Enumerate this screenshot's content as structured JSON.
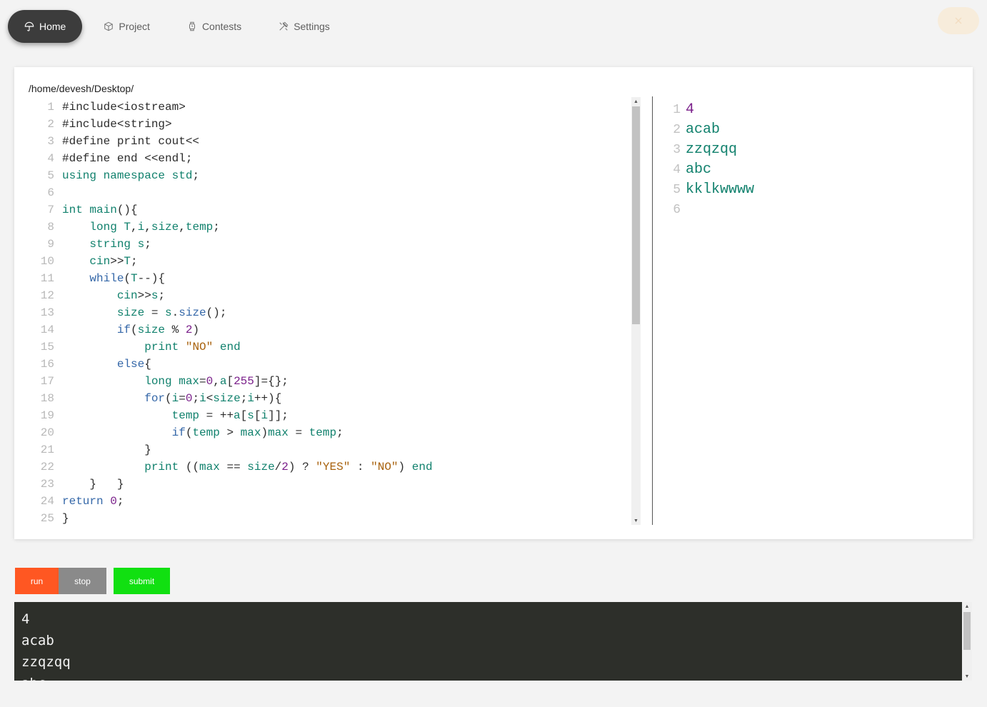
{
  "nav": {
    "items": [
      {
        "label": "Home",
        "icon": "umbrella-icon",
        "active": true
      },
      {
        "label": "Project",
        "icon": "cube-icon",
        "active": false
      },
      {
        "label": "Contests",
        "icon": "watch-icon",
        "active": false
      },
      {
        "label": "Settings",
        "icon": "tools-icon",
        "active": false
      }
    ],
    "close_icon": "close-icon"
  },
  "editor": {
    "path": "/home/devesh/Desktop/",
    "lines": [
      {
        "n": "1",
        "tokens": [
          [
            "t",
            "#include<iostream>"
          ]
        ]
      },
      {
        "n": "2",
        "tokens": [
          [
            "t",
            "#include<string>"
          ]
        ]
      },
      {
        "n": "3",
        "tokens": [
          [
            "t",
            "#define print cout<<"
          ]
        ]
      },
      {
        "n": "4",
        "tokens": [
          [
            "t",
            "#define end <<endl;"
          ]
        ]
      },
      {
        "n": "5",
        "tokens": [
          [
            "ty",
            "using namespace std"
          ],
          [
            "t",
            ";"
          ]
        ]
      },
      {
        "n": "6",
        "tokens": []
      },
      {
        "n": "7",
        "tokens": [
          [
            "ty",
            "int main"
          ],
          [
            "t",
            "(){"
          ]
        ]
      },
      {
        "n": "8",
        "tokens": [
          [
            "t",
            "    "
          ],
          [
            "ty",
            "long T"
          ],
          [
            "t",
            ","
          ],
          [
            "ty",
            "i"
          ],
          [
            "t",
            ","
          ],
          [
            "ty",
            "size"
          ],
          [
            "t",
            ","
          ],
          [
            "ty",
            "temp"
          ],
          [
            "t",
            ";"
          ]
        ]
      },
      {
        "n": "9",
        "tokens": [
          [
            "t",
            "    "
          ],
          [
            "ty",
            "string s"
          ],
          [
            "t",
            ";"
          ]
        ]
      },
      {
        "n": "10",
        "tokens": [
          [
            "t",
            "    "
          ],
          [
            "ty",
            "cin"
          ],
          [
            "t",
            ">>"
          ],
          [
            "ty",
            "T"
          ],
          [
            "t",
            ";"
          ]
        ]
      },
      {
        "n": "11",
        "tokens": [
          [
            "t",
            "    "
          ],
          [
            "kw",
            "while"
          ],
          [
            "t",
            "("
          ],
          [
            "ty",
            "T"
          ],
          [
            "t",
            "--){"
          ]
        ]
      },
      {
        "n": "12",
        "tokens": [
          [
            "t",
            "        "
          ],
          [
            "ty",
            "cin"
          ],
          [
            "t",
            ">>"
          ],
          [
            "ty",
            "s"
          ],
          [
            "t",
            ";"
          ]
        ]
      },
      {
        "n": "13",
        "tokens": [
          [
            "t",
            "        "
          ],
          [
            "ty",
            "size"
          ],
          [
            "t",
            " = "
          ],
          [
            "ty",
            "s"
          ],
          [
            "t",
            "."
          ],
          [
            "kw",
            "size"
          ],
          [
            "t",
            "();"
          ]
        ]
      },
      {
        "n": "14",
        "tokens": [
          [
            "t",
            "        "
          ],
          [
            "kw",
            "if"
          ],
          [
            "t",
            "("
          ],
          [
            "ty",
            "size"
          ],
          [
            "t",
            " % "
          ],
          [
            "nm",
            "2"
          ],
          [
            "t",
            ")"
          ]
        ]
      },
      {
        "n": "15",
        "tokens": [
          [
            "t",
            "            "
          ],
          [
            "ty",
            "print"
          ],
          [
            "t",
            " "
          ],
          [
            "st",
            "\"NO\""
          ],
          [
            "t",
            " "
          ],
          [
            "ty",
            "end"
          ]
        ]
      },
      {
        "n": "16",
        "tokens": [
          [
            "t",
            "        "
          ],
          [
            "kw",
            "else"
          ],
          [
            "t",
            "{"
          ]
        ]
      },
      {
        "n": "17",
        "tokens": [
          [
            "t",
            "            "
          ],
          [
            "ty",
            "long max"
          ],
          [
            "t",
            "="
          ],
          [
            "nm",
            "0"
          ],
          [
            "t",
            ","
          ],
          [
            "ty",
            "a"
          ],
          [
            "t",
            "["
          ],
          [
            "nm",
            "255"
          ],
          [
            "t",
            "]={};"
          ]
        ]
      },
      {
        "n": "18",
        "tokens": [
          [
            "t",
            "            "
          ],
          [
            "kw",
            "for"
          ],
          [
            "t",
            "("
          ],
          [
            "ty",
            "i"
          ],
          [
            "t",
            "="
          ],
          [
            "nm",
            "0"
          ],
          [
            "t",
            ";"
          ],
          [
            "ty",
            "i"
          ],
          [
            "t",
            "<"
          ],
          [
            "ty",
            "size"
          ],
          [
            "t",
            ";"
          ],
          [
            "ty",
            "i"
          ],
          [
            "t",
            "++){"
          ]
        ]
      },
      {
        "n": "19",
        "tokens": [
          [
            "t",
            "                "
          ],
          [
            "ty",
            "temp"
          ],
          [
            "t",
            " = ++"
          ],
          [
            "ty",
            "a"
          ],
          [
            "t",
            "["
          ],
          [
            "ty",
            "s"
          ],
          [
            "t",
            "["
          ],
          [
            "ty",
            "i"
          ],
          [
            "t",
            "]];"
          ]
        ]
      },
      {
        "n": "20",
        "tokens": [
          [
            "t",
            "                "
          ],
          [
            "kw",
            "if"
          ],
          [
            "t",
            "("
          ],
          [
            "ty",
            "temp"
          ],
          [
            "t",
            " > "
          ],
          [
            "ty",
            "max"
          ],
          [
            "t",
            ")"
          ],
          [
            "ty",
            "max"
          ],
          [
            "t",
            " = "
          ],
          [
            "ty",
            "temp"
          ],
          [
            "t",
            ";"
          ]
        ]
      },
      {
        "n": "21",
        "tokens": [
          [
            "t",
            "            }"
          ]
        ]
      },
      {
        "n": "22",
        "tokens": [
          [
            "t",
            "            "
          ],
          [
            "ty",
            "print"
          ],
          [
            "t",
            " (("
          ],
          [
            "ty",
            "max"
          ],
          [
            "t",
            " == "
          ],
          [
            "ty",
            "size"
          ],
          [
            "t",
            "/"
          ],
          [
            "nm",
            "2"
          ],
          [
            "t",
            ") ? "
          ],
          [
            "st",
            "\"YES\""
          ],
          [
            "t",
            " : "
          ],
          [
            "st",
            "\"NO\""
          ],
          [
            "t",
            ") "
          ],
          [
            "ty",
            "end"
          ]
        ]
      },
      {
        "n": "23",
        "tokens": [
          [
            "t",
            "    }   }"
          ]
        ]
      },
      {
        "n": "24",
        "tokens": [
          [
            "kw",
            "return"
          ],
          [
            "t",
            " "
          ],
          [
            "nm",
            "0"
          ],
          [
            "t",
            ";"
          ]
        ]
      },
      {
        "n": "25",
        "tokens": [
          [
            "t",
            "}"
          ]
        ]
      }
    ]
  },
  "input_pane": {
    "lines": [
      {
        "n": "1",
        "text": "4",
        "cls": "nm"
      },
      {
        "n": "2",
        "text": "acab",
        "cls": "ty"
      },
      {
        "n": "3",
        "text": "zzqzqq",
        "cls": "ty"
      },
      {
        "n": "4",
        "text": "abc",
        "cls": "ty"
      },
      {
        "n": "5",
        "text": "kklkwwww",
        "cls": "ty"
      },
      {
        "n": "6",
        "text": "",
        "cls": "ty"
      }
    ]
  },
  "buttons": {
    "run": "run",
    "stop": "stop",
    "submit": "submit"
  },
  "console": {
    "lines": [
      "4",
      "acab",
      "zzqzqq",
      "abc"
    ]
  },
  "colors": {
    "run": "#ff5722",
    "stop": "#8a8a8a",
    "submit": "#11e011",
    "console_bg": "#2d2f2a",
    "nav_active": "#3c3c3c"
  }
}
